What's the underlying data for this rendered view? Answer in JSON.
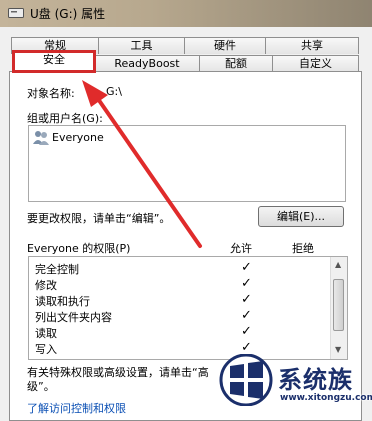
{
  "window": {
    "title": "U盘 (G:) 属性",
    "title_bar_color": "#b9ab92"
  },
  "tabs": {
    "row1": [
      "常规",
      "工具",
      "硬件",
      "共享"
    ],
    "row2": [
      "安全",
      "ReadyBoost",
      "配额",
      "自定义"
    ],
    "active": "安全",
    "highlight_color": "#d22a2a"
  },
  "security": {
    "object_name_label": "对象名称:",
    "object_name_value": "G:\\",
    "group_label": "组或用户名(G):",
    "users": [
      "Everyone"
    ],
    "change_hint": "要更改权限，请单击“编辑”。",
    "edit_button": "编辑(E)...",
    "perm_header": "Everyone 的权限(P)",
    "allow_header": "允许",
    "deny_header": "拒绝",
    "permissions": [
      {
        "name": "完全控制",
        "allow": "✓"
      },
      {
        "name": "修改",
        "allow": "✓"
      },
      {
        "name": "读取和执行",
        "allow": "✓"
      },
      {
        "name": "列出文件夹内容",
        "allow": "✓"
      },
      {
        "name": "读取",
        "allow": "✓"
      },
      {
        "name": "写入",
        "allow": "✓"
      }
    ],
    "special_hint_line1": "有关特殊权限或高级设置，请单击“高",
    "special_hint_line2": "级”。",
    "learn_link": "了解访问控制和权限"
  },
  "watermark": {
    "brand": "系统族",
    "url": "www.xitongzu.com"
  }
}
